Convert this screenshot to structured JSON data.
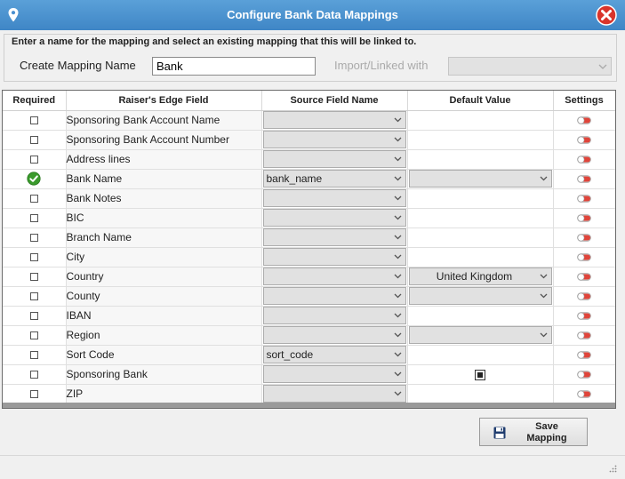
{
  "window": {
    "title": "Configure Bank Data Mappings"
  },
  "top": {
    "instruction": "Enter a name for the mapping and select an existing mapping that this will be linked to.",
    "create_label": "Create Mapping Name",
    "name_value": "Bank",
    "import_label": "Import/Linked with",
    "import_value": ""
  },
  "grid": {
    "columns": [
      "Required",
      "Raiser's Edge Field",
      "Source Field Name",
      "Default Value",
      "Settings"
    ],
    "rows": [
      {
        "required": false,
        "field": "Sponsoring Bank Account Name",
        "source": "",
        "default_type": "text",
        "default": ""
      },
      {
        "required": false,
        "field": "Sponsoring Bank Account Number",
        "source": "",
        "default_type": "text",
        "default": ""
      },
      {
        "required": false,
        "field": "Address lines",
        "source": "",
        "default_type": "text",
        "default": ""
      },
      {
        "required": true,
        "field": "Bank Name",
        "source": "bank_name",
        "default_type": "select",
        "default": ""
      },
      {
        "required": false,
        "field": "Bank Notes",
        "source": "",
        "default_type": "text",
        "default": ""
      },
      {
        "required": false,
        "field": "BIC",
        "source": "",
        "default_type": "text",
        "default": ""
      },
      {
        "required": false,
        "field": "Branch Name",
        "source": "",
        "default_type": "text",
        "default": ""
      },
      {
        "required": false,
        "field": "City",
        "source": "",
        "default_type": "text",
        "default": ""
      },
      {
        "required": false,
        "field": "Country",
        "source": "",
        "default_type": "select",
        "default": "United Kingdom"
      },
      {
        "required": false,
        "field": "County",
        "source": "",
        "default_type": "select",
        "default": ""
      },
      {
        "required": false,
        "field": "IBAN",
        "source": "",
        "default_type": "text",
        "default": ""
      },
      {
        "required": false,
        "field": "Region",
        "source": "",
        "default_type": "select",
        "default": ""
      },
      {
        "required": false,
        "field": "Sort Code",
        "source": "sort_code",
        "default_type": "text",
        "default": ""
      },
      {
        "required": false,
        "field": "Sponsoring Bank",
        "source": "",
        "default_type": "checkbox",
        "default": ""
      },
      {
        "required": false,
        "field": "ZIP",
        "source": "",
        "default_type": "text",
        "default": ""
      }
    ]
  },
  "save_button": {
    "label": "Save\nMapping"
  },
  "icons": {
    "title_pin": "map-pin-icon",
    "close": "close-icon",
    "required_ok": "check-circle-icon",
    "settings_toggle": "toggle-icon",
    "save": "floppy-disk-icon"
  },
  "colors": {
    "title_bar": "#4a90d0",
    "close_red": "#d9342b",
    "ok_green": "#3a9a2c"
  }
}
